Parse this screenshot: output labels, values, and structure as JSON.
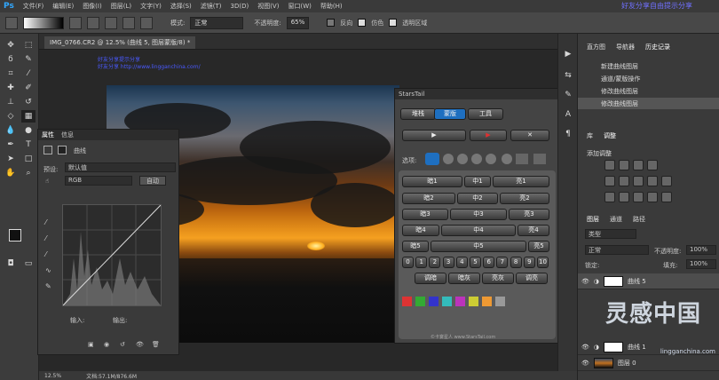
{
  "app": {
    "logo": "Ps",
    "menu": [
      "文件(F)",
      "编辑(E)",
      "图像(I)",
      "图层(L)",
      "文字(Y)",
      "选择(S)",
      "滤镜(T)",
      "3D(D)",
      "视图(V)",
      "窗口(W)",
      "帮助(H)"
    ],
    "watermark": "好友分享自由提示分享",
    "accent": "#31a8ff"
  },
  "options": {
    "mode_label": "模式:",
    "mode_value": "正常",
    "opacity_label": "不透明度:",
    "opacity_value": "65%",
    "reverse": "反向",
    "dither": "仿色",
    "transparency": "透明区域"
  },
  "document": {
    "tab": "IMG_0766.CR2 @ 12.5% (曲线 5, 图层蒙版/8) *",
    "overlay1": "好友分享提示分享",
    "overlay2": "好友分享 http://www.lingganchina.com/"
  },
  "status": {
    "zoom": "12.5%",
    "doc": "文档:57.1M/876.6M"
  },
  "properties": {
    "tab1": "属性",
    "tab2": "信息",
    "title": "曲线",
    "preset_label": "预设:",
    "preset_value": "默认值",
    "channel": "RGB",
    "auto": "自动",
    "input": "输入:",
    "output": "输出:"
  },
  "starstail": {
    "title": "StarsTail",
    "tabs": [
      "堆栈",
      "蒙版",
      "工具"
    ],
    "select_label": "选项:",
    "grid": [
      [
        "暗1",
        "中1",
        "亮1"
      ],
      [
        "暗2",
        "中2",
        "亮2"
      ],
      [
        "暗3",
        "中3",
        "亮3"
      ],
      [
        "暗4",
        "中4",
        "亮4"
      ],
      [
        "暗5",
        "中5",
        "亮5"
      ]
    ],
    "numbers": [
      "0",
      "1",
      "2",
      "3",
      "4",
      "5",
      "6",
      "7",
      "8",
      "9",
      "10"
    ],
    "bottom": [
      "调暗",
      "暗灰",
      "亮灰",
      "调亮"
    ],
    "footer": "©卡宴星人 www.StarsTail.com"
  },
  "history": {
    "tabs": [
      "直方图",
      "导航器",
      "历史记录"
    ],
    "items": [
      "新建曲线图层",
      "通道/蒙版操作",
      "修改曲线图层",
      "修改曲线图层"
    ]
  },
  "adjust": {
    "tabs": [
      "库",
      "调整"
    ],
    "label": "添加调整"
  },
  "layers": {
    "tabs": [
      "图层",
      "通道",
      "路径"
    ],
    "kind": "类型",
    "blend": "正常",
    "opacity_label": "不透明度:",
    "opacity": "100%",
    "lock_label": "锁定:",
    "fill_label": "填充:",
    "fill": "100%",
    "items": [
      "曲线 5",
      "曲线 1",
      "图层 0"
    ]
  },
  "watermark": {
    "logo": "灵感中国",
    "url": "lingganchina.com"
  }
}
